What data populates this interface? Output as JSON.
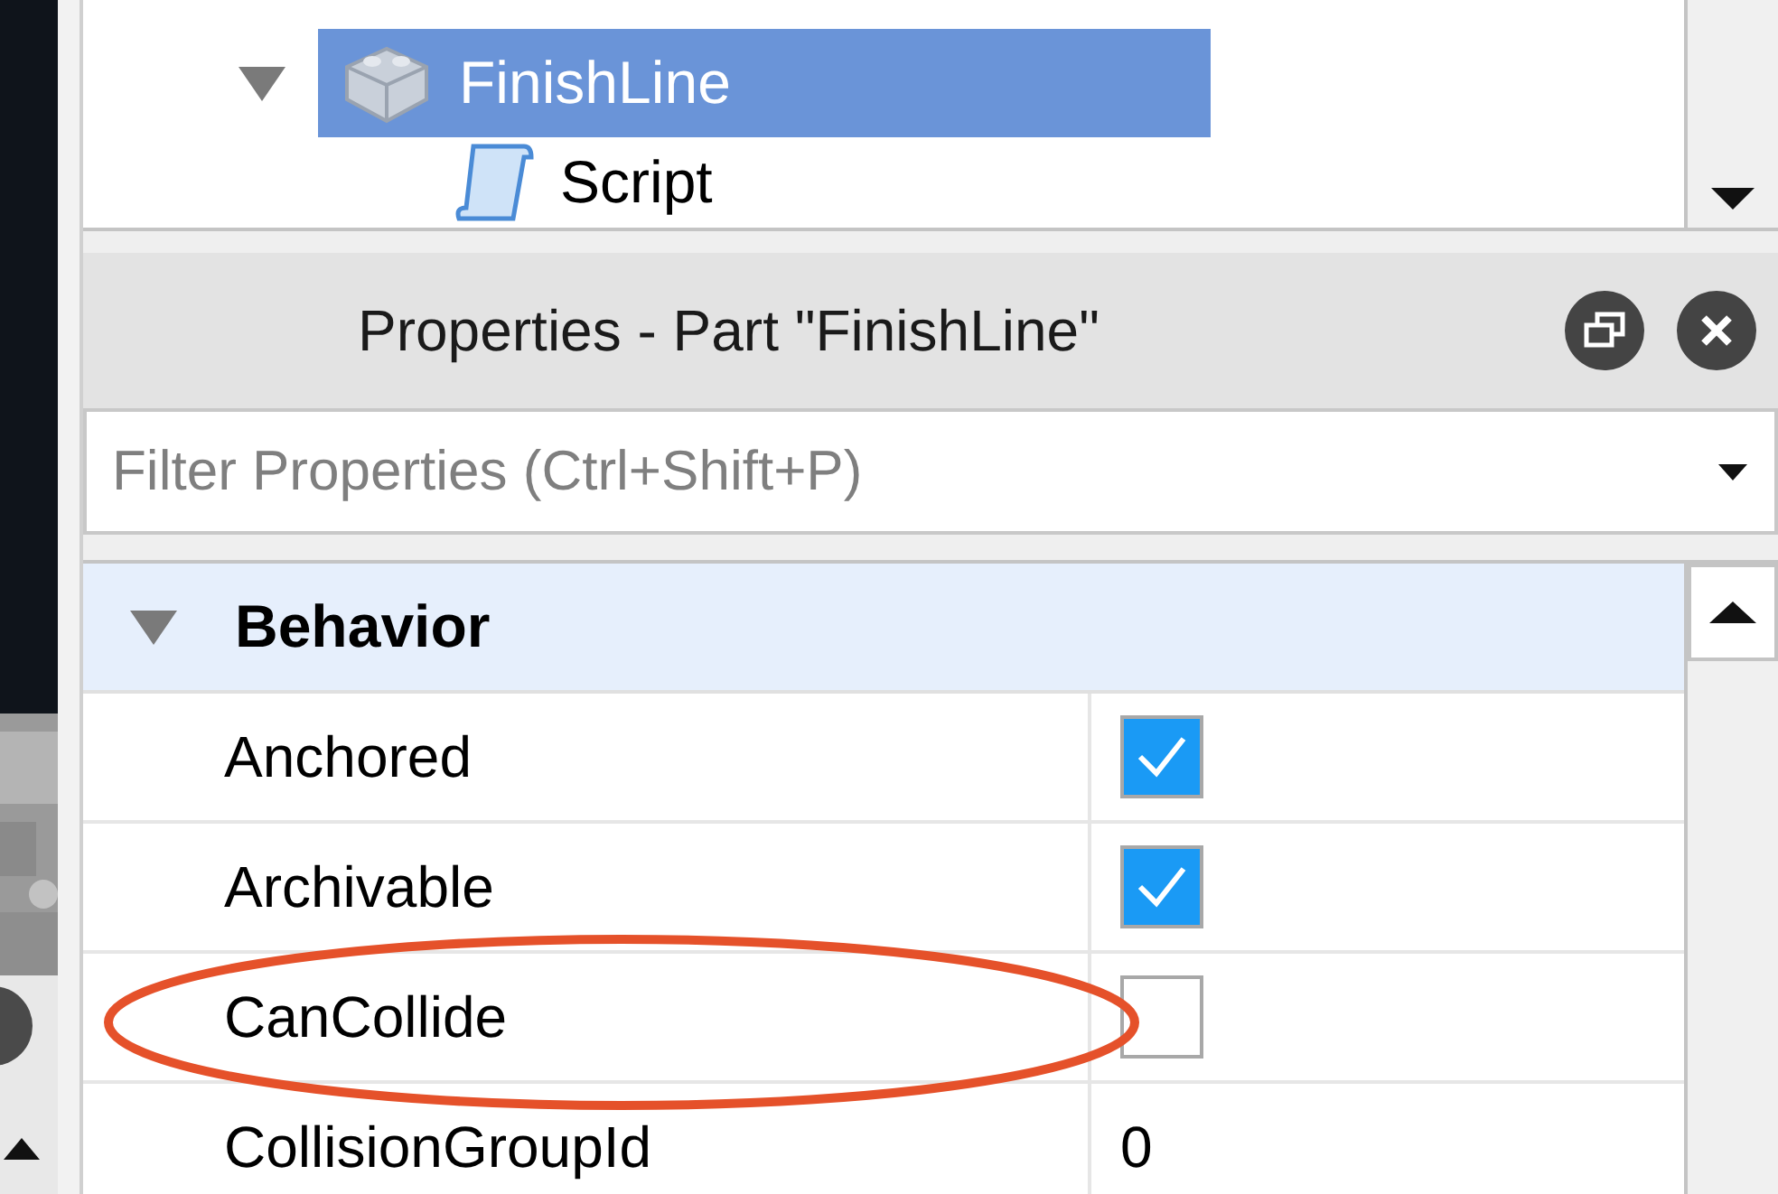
{
  "explorer": {
    "items": [
      {
        "label": "FinishLine",
        "kind": "part",
        "selected": true,
        "expanded": true,
        "children": [
          {
            "label": "Script",
            "kind": "script",
            "selected": false
          }
        ]
      }
    ]
  },
  "properties": {
    "title": "Properties - Part \"FinishLine\"",
    "filter": {
      "placeholder": "Filter Properties (Ctrl+Shift+P)"
    },
    "categories": [
      {
        "name": "Behavior",
        "expanded": true,
        "rows": [
          {
            "name": "Anchored",
            "kind": "checkbox",
            "checked": true,
            "highlighted": false
          },
          {
            "name": "Archivable",
            "kind": "checkbox",
            "checked": true,
            "highlighted": false
          },
          {
            "name": "CanCollide",
            "kind": "checkbox",
            "checked": false,
            "highlighted": true
          },
          {
            "name": "CollisionGroupId",
            "kind": "text",
            "value": "0",
            "highlighted": false
          }
        ]
      }
    ]
  }
}
